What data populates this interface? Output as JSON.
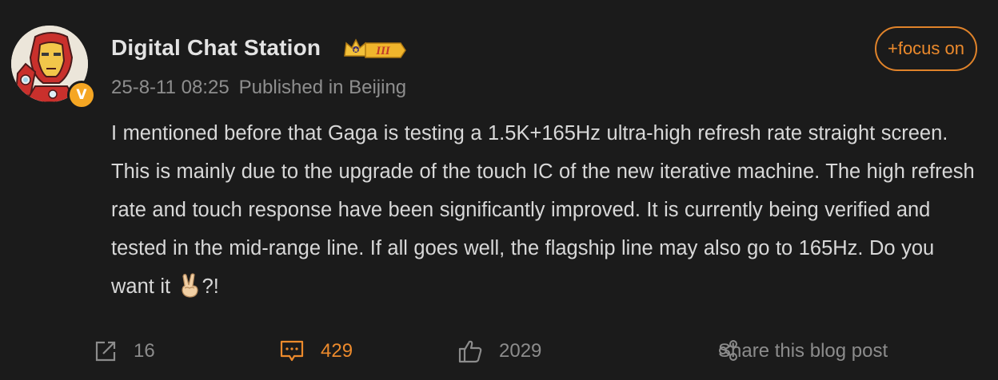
{
  "post": {
    "author": {
      "name": "Digital Chat Station",
      "level_badge": "III",
      "verified_mark": "V"
    },
    "timestamp": "25-8-11 08:25",
    "location": "Published in Beijing",
    "follow_label": "+focus on",
    "content": "I mentioned before that Gaga is testing a 1.5K+165Hz ultra-high refresh rate straight screen. This is mainly due to the upgrade of the touch IC of the new iterative machine. The high refresh rate and touch response have been significantly improved. It is currently being verified and tested in the mid-range line. If all goes well, the flagship line may also go to 165Hz. Do you want it",
    "content_end": "?!",
    "content_emoji": "victory-hand-emoji"
  },
  "actions": {
    "repost_count": "16",
    "comment_count": "429",
    "like_count": "2029",
    "share_label": "Share this blog post"
  },
  "colors": {
    "background": "#1b1b1b",
    "accent": "#ec8a2c",
    "text": "#d8d8d8",
    "muted": "#8e8e8e"
  }
}
